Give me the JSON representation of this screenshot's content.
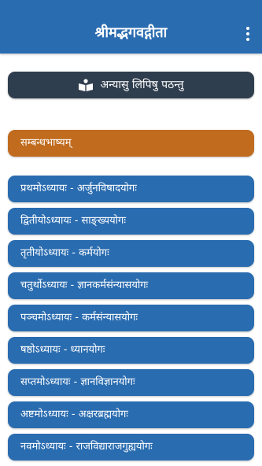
{
  "app": {
    "title": "श्रीमद्भगवद्गीता"
  },
  "header": {
    "menu_icon": "more-vert-icon"
  },
  "script_button": {
    "icon": "open-book-icon",
    "label": "अन्यासु लिपिषु पठन्तु"
  },
  "intro": {
    "label": "सम्बन्धभाष्यम्"
  },
  "chapters": [
    {
      "label": "प्रथमोऽध्यायः - अर्जुनविषादयोगः"
    },
    {
      "label": "द्वितीयोऽध्यायः - साङ्ख्ययोगः"
    },
    {
      "label": "तृतीयोऽध्यायः - कर्मयोगः"
    },
    {
      "label": "चतुर्थोऽध्यायः - ज्ञानकर्मसंन्यासयोगः"
    },
    {
      "label": "पञ्चमोऽध्यायः - कर्मसंन्यासयोगः"
    },
    {
      "label": "षष्ठोऽध्यायः - ध्यानयोगः"
    },
    {
      "label": "सप्तमोऽध्यायः - ज्ञानविज्ञानयोगः"
    },
    {
      "label": "अष्टमोऽध्यायः - अक्षरब्रह्मयोगः"
    },
    {
      "label": "नवमोऽध्यायः - राजविद्याराजगुह्ययोगः"
    }
  ],
  "colors": {
    "appbar": "#2a6cb0",
    "script_button": "#2f3e4e",
    "intro": "#c06b1e",
    "chapter": "#2a6cb0"
  }
}
